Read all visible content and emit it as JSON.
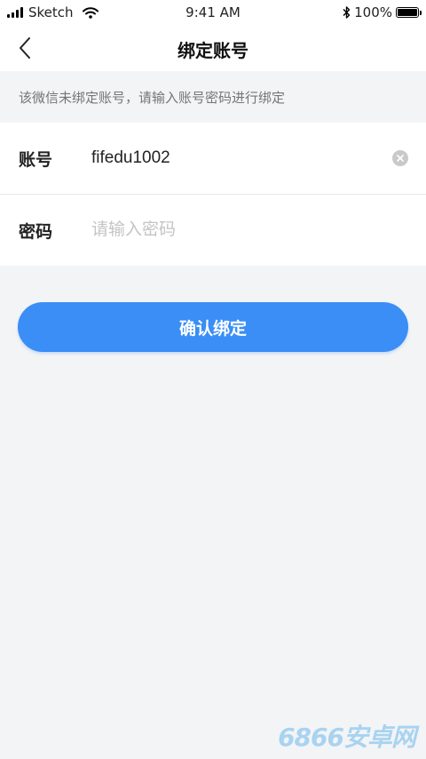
{
  "status_bar": {
    "carrier": "Sketch",
    "time": "9:41 AM",
    "battery": "100%"
  },
  "nav": {
    "title": "绑定账号",
    "back_icon": "chevron-left-icon"
  },
  "hint": "该微信未绑定账号，请输入账号密码进行绑定",
  "form": {
    "account": {
      "label": "账号",
      "value": "fifedu1002",
      "clear_icon": "clear-icon"
    },
    "password": {
      "label": "密码",
      "placeholder": "请输入密码"
    }
  },
  "confirm_button": "确认绑定",
  "watermark": "6866安卓网",
  "colors": {
    "primary": "#3a8ef6",
    "background": "#f3f4f6",
    "hint_text": "#757575",
    "placeholder": "#c4c4c4"
  }
}
